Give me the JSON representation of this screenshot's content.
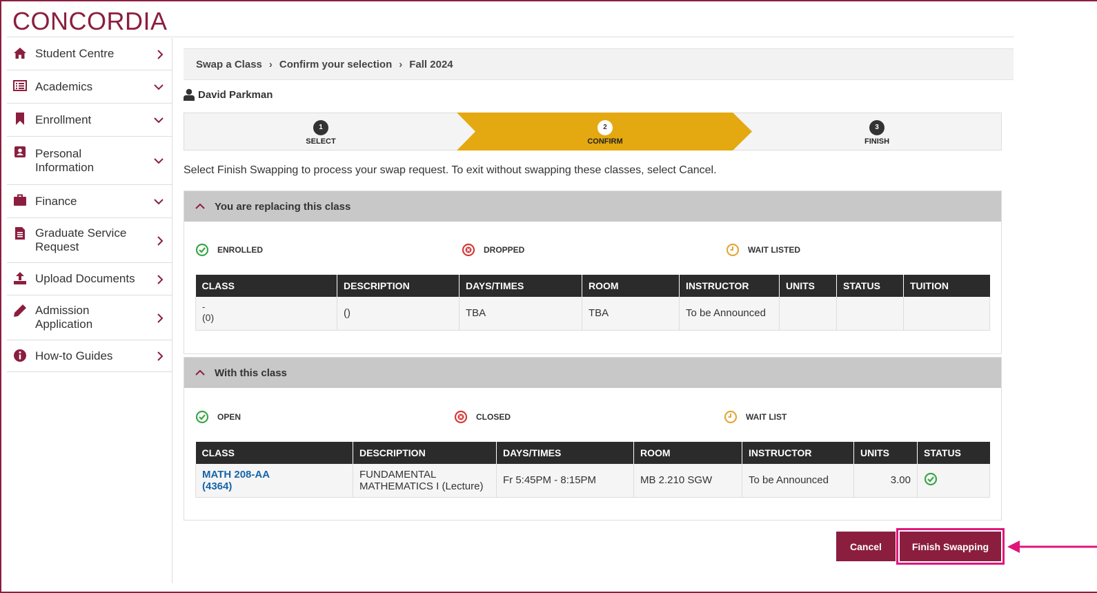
{
  "brand": {
    "logo_text": "CONCORDIA"
  },
  "sidebar": {
    "items": [
      {
        "label": "Student Centre",
        "icon": "home-icon",
        "chevron": "right"
      },
      {
        "label": "Academics",
        "icon": "list-icon",
        "chevron": "down"
      },
      {
        "label": "Enrollment",
        "icon": "bookmark-icon",
        "chevron": "down"
      },
      {
        "label": "Personal Information",
        "icon": "id-card-icon",
        "chevron": "down"
      },
      {
        "label": "Finance",
        "icon": "briefcase-icon",
        "chevron": "down"
      },
      {
        "label": "Graduate Service Request",
        "icon": "document-icon",
        "chevron": "right"
      },
      {
        "label": "Upload Documents",
        "icon": "upload-icon",
        "chevron": "right"
      },
      {
        "label": "Admission Application",
        "icon": "pencil-icon",
        "chevron": "right"
      },
      {
        "label": "How-to Guides",
        "icon": "info-icon",
        "chevron": "right"
      }
    ]
  },
  "breadcrumb": {
    "items": [
      "Swap a Class",
      "Confirm your selection",
      "Fall 2024"
    ]
  },
  "user": {
    "name": "David Parkman"
  },
  "steps": [
    {
      "num": "1",
      "label": "SELECT"
    },
    {
      "num": "2",
      "label": "CONFIRM"
    },
    {
      "num": "3",
      "label": "FINISH"
    }
  ],
  "instructions": "Select Finish Swapping to process your swap request.  To exit without swapping these classes, select Cancel.",
  "replacing": {
    "title": "You are replacing this class",
    "legend": [
      "ENROLLED",
      "DROPPED",
      "WAIT LISTED"
    ],
    "columns": [
      "CLASS",
      "DESCRIPTION",
      "DAYS/TIMES",
      "ROOM",
      "INSTRUCTOR",
      "UNITS",
      "STATUS",
      "TUITION"
    ],
    "row": {
      "class_line1": "-",
      "class_line2": "(0)",
      "description": "()",
      "days_times": "TBA",
      "room": "TBA",
      "instructor": "To be Announced",
      "units": "",
      "status": "",
      "tuition": ""
    }
  },
  "with_class": {
    "title": "With this class",
    "legend": [
      "OPEN",
      "CLOSED",
      "WAIT LIST"
    ],
    "columns": [
      "CLASS",
      "DESCRIPTION",
      "DAYS/TIMES",
      "ROOM",
      "INSTRUCTOR",
      "UNITS",
      "STATUS"
    ],
    "row": {
      "class_line1": "MATH 208-AA",
      "class_line2": "(4364)",
      "description_line1": "FUNDAMENTAL",
      "description_line2": "MATHEMATICS I (Lecture)",
      "days_times": "Fr 5:45PM - 8:15PM",
      "room": "MB 2.210 SGW",
      "instructor": "To be Announced",
      "units": "3.00",
      "status_icon": "open-status-icon"
    }
  },
  "buttons": {
    "cancel": "Cancel",
    "finish": "Finish Swapping"
  },
  "colors": {
    "brand": "#8b1e3f",
    "step_active": "#e4a810",
    "highlight": "#e0157b",
    "open": "#3aa64a",
    "closed": "#d43a3a",
    "waitlist": "#e3a83b"
  }
}
